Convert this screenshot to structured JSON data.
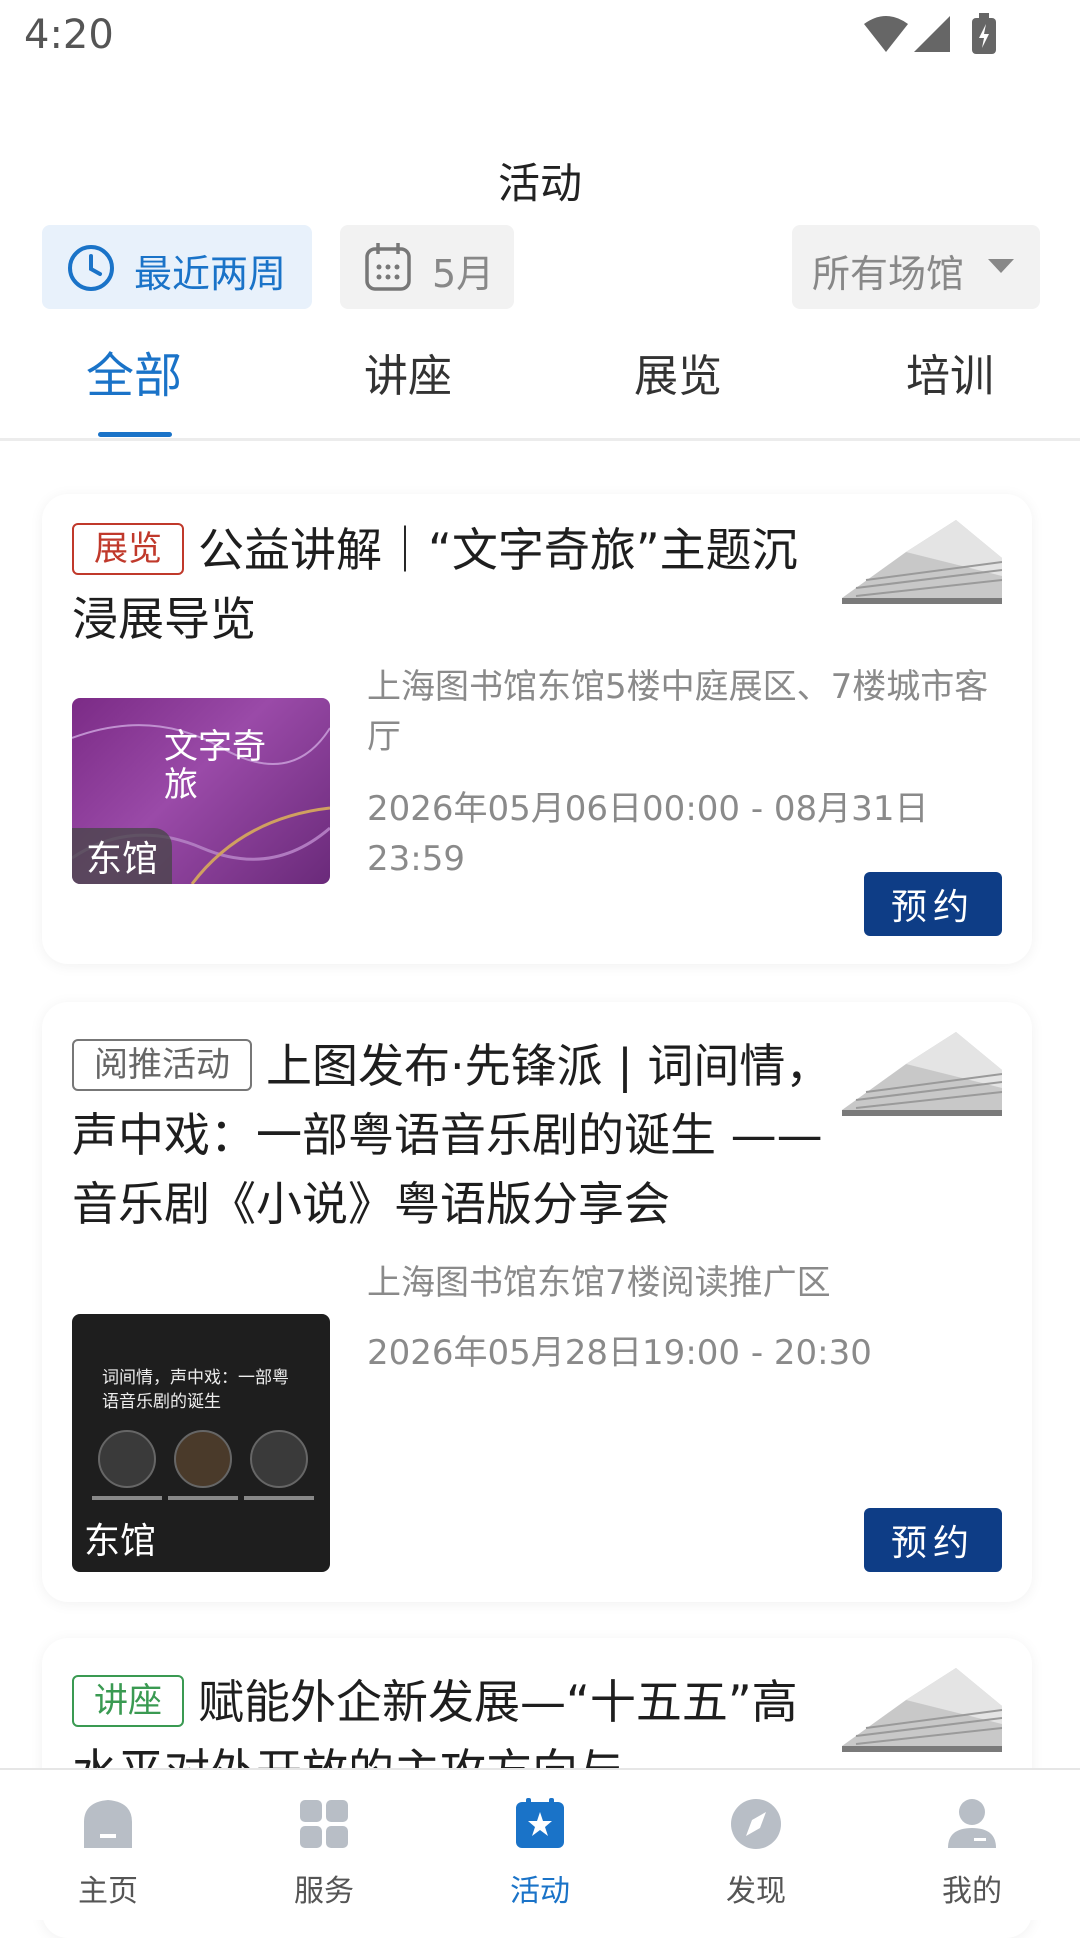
{
  "status": {
    "time": "4:20"
  },
  "page_title": "活动",
  "filters": {
    "recent": "最近两周",
    "month": "5月",
    "venue": "所有场馆"
  },
  "tabs": [
    "全部",
    "讲座",
    "展览",
    "培训"
  ],
  "events": [
    {
      "tag": "展览",
      "title": "公益讲解｜“文字奇旅”主题沉浸展导览",
      "location": "上海图书馆东馆5楼中庭展区、7楼城市客厅",
      "time": "2026年05月06日00:00 - 08月31日23:59",
      "poster_label": "东馆",
      "poster_text": "文字奇旅",
      "action": "预约"
    },
    {
      "tag": "阅推活动",
      "title": "上图发布·先锋派 | 词间情，声中戏：一部粤语音乐剧的诞生 ——音乐剧《小说》粤语版分享会",
      "location": "上海图书馆东馆7楼阅读推广区",
      "time": "2026年05月28日19:00 - 20:30",
      "poster_label": "东馆",
      "poster_text": "词间情，声中戏：一部粤语音乐剧的诞生",
      "action": "预约"
    },
    {
      "tag": "讲座",
      "title": "赋能外企新发展—“十五五”高水平对外开放的主攻方向与"
    }
  ],
  "nav": [
    "主页",
    "服务",
    "活动",
    "发现",
    "我的"
  ],
  "colors": {
    "accent": "#1a73c8",
    "reserve_button": "#0e3d86",
    "tag_exhibition": "#c0392b",
    "tag_lecture": "#3a9a52"
  }
}
